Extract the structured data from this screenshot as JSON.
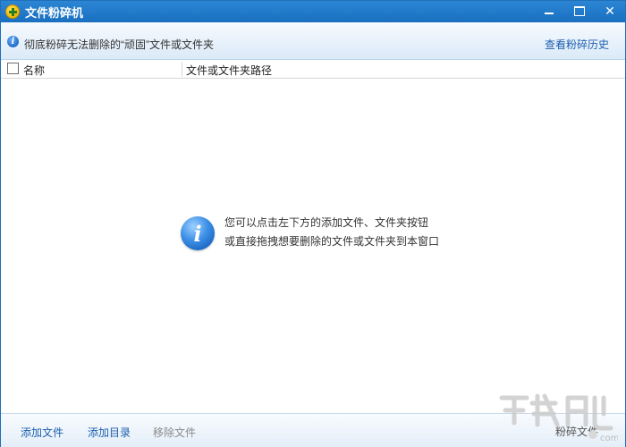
{
  "window": {
    "title": "文件粉碎机",
    "controls": [
      "minimize",
      "maximize",
      "close"
    ]
  },
  "info_bar": {
    "icon": "info-icon",
    "text": "彻底粉碎无法删除的“顽固”文件或文件夹",
    "history_link": "查看粉碎历史"
  },
  "table": {
    "columns": [
      "名称",
      "文件或文件夹路径"
    ],
    "rows": []
  },
  "empty_state": {
    "icon": "info-icon",
    "line1": "您可以点击左下方的添加文件、文件夹按钮",
    "line2": "或直接拖拽想要删除的文件或文件夹到本窗口"
  },
  "bottom_bar": {
    "add_file": "添加文件",
    "add_folder": "添加目录",
    "remove_file": "移除文件",
    "shred": "粉碎文件"
  },
  "colors": {
    "titlebar": "#1a6fc0",
    "link": "#1d5fae",
    "disabled": "#8a8a8a"
  }
}
